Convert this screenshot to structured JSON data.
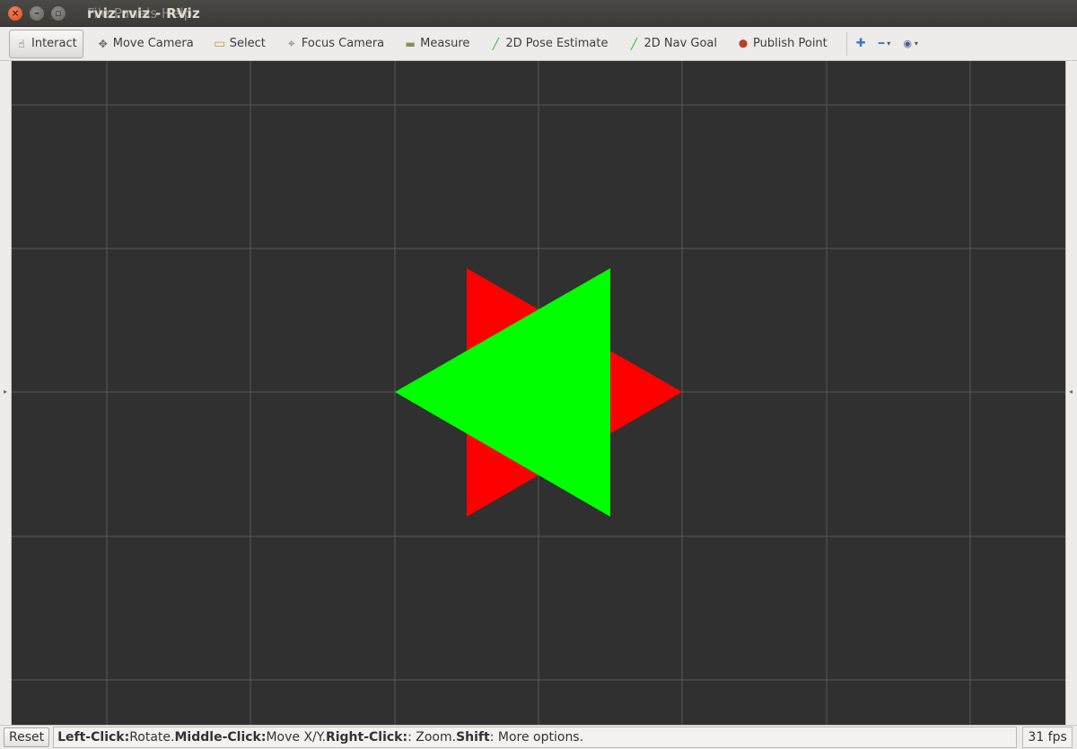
{
  "window": {
    "title": "rviz.rviz - RViz",
    "title_ghost": "File Panels Help",
    "close_glyph": "×",
    "min_glyph": "–",
    "max_glyph": "▫"
  },
  "toolbar": {
    "tools": [
      {
        "label": "Interact",
        "icon": "hand-pointer-icon",
        "glyph": "☝",
        "active": true
      },
      {
        "label": "Move Camera",
        "icon": "move-camera-icon",
        "glyph": "✥"
      },
      {
        "label": "Select",
        "icon": "select-box-icon",
        "glyph": "▭"
      },
      {
        "label": "Focus Camera",
        "icon": "focus-camera-icon",
        "glyph": "⌖"
      },
      {
        "label": "Measure",
        "icon": "ruler-icon",
        "glyph": "▬"
      },
      {
        "label": "2D Pose Estimate",
        "icon": "green-arrow-icon",
        "glyph": "╱"
      },
      {
        "label": "2D Nav Goal",
        "icon": "green-arrow-icon",
        "glyph": "╱"
      },
      {
        "label": "Publish Point",
        "icon": "map-pin-icon",
        "glyph": "⬤"
      }
    ],
    "add_tool_glyph": "✚",
    "remove_tool_glyph": "━",
    "view_glyph": "◉",
    "caret_glyph": "▾"
  },
  "viewport": {
    "background": "#303030",
    "grid_color": "#585858",
    "shapes": [
      {
        "name": "red-triangle",
        "color": "#ff0000"
      },
      {
        "name": "green-triangle",
        "color": "#00ff00"
      }
    ]
  },
  "panel_arrows": {
    "left": "▸",
    "right": "◂"
  },
  "statusbar": {
    "reset_label": "Reset",
    "help": [
      {
        "key": "Left-Click:",
        "text": " Rotate. "
      },
      {
        "key": "Middle-Click:",
        "text": " Move X/Y. "
      },
      {
        "key": "Right-Click:",
        "text": ": Zoom. "
      },
      {
        "key": "Shift",
        "text": ": More options."
      }
    ],
    "fps": "31 fps"
  }
}
